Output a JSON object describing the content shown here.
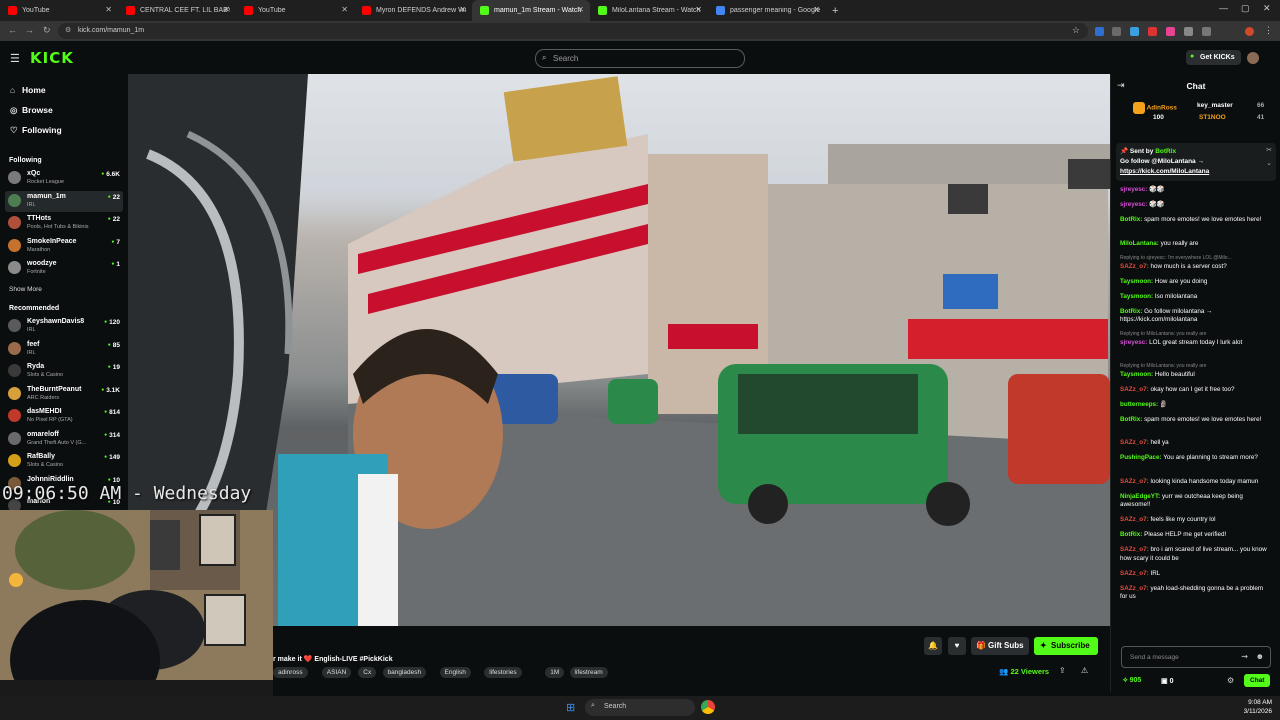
{
  "browser": {
    "tabs": [
      {
        "label": "YouTube",
        "color": "#ff0000",
        "active": false
      },
      {
        "label": "CENTRAL CEE FT. LIL BABY - BA",
        "color": "#ff0000",
        "active": false
      },
      {
        "label": "YouTube",
        "color": "#ff0000",
        "active": false
      },
      {
        "label": "Myron DEFENDS Andrew Wilso",
        "color": "#ff0000",
        "active": false
      },
      {
        "label": "mamun_1m Stream - Watch",
        "color": "#53fc18",
        "active": true
      },
      {
        "label": "MiloLantana Stream - Watch Li",
        "color": "#53fc18",
        "active": false
      },
      {
        "label": "passenger meaning - Google S",
        "color": "#4285f4",
        "active": false
      }
    ],
    "new_tab": "+",
    "url": "kick.com/mamun_1m"
  },
  "kick": {
    "logo": "KICK",
    "search_placeholder": "Search",
    "get_kicks": "Get KICKs"
  },
  "sidebar": {
    "nav": [
      {
        "label": "Home",
        "icon": "home-icon"
      },
      {
        "label": "Browse",
        "icon": "compass-icon"
      },
      {
        "label": "Following",
        "icon": "heart-icon"
      }
    ],
    "following_title": "Following",
    "following": [
      {
        "name": "xQc",
        "category": "Rocket League",
        "viewers": "6.6K",
        "color": "#7a7a7a"
      },
      {
        "name": "mamun_1m",
        "category": "IRL",
        "viewers": "22",
        "color": "#4e7d52"
      },
      {
        "name": "TTHots",
        "category": "Pools, Hot Tubs & Bikinis",
        "viewers": "22",
        "color": "#b0503a"
      },
      {
        "name": "SmokeInPeace",
        "category": "Marathon",
        "viewers": "7",
        "color": "#c4722e"
      },
      {
        "name": "woodzye",
        "category": "Fortnite",
        "viewers": "1",
        "color": "#8a8a8a"
      }
    ],
    "show_more": "Show More",
    "recommended_title": "Recommended",
    "recommended": [
      {
        "name": "KeyshawnDavis8",
        "category": "IRL",
        "viewers": "120",
        "color": "#5a5a5a"
      },
      {
        "name": "feef",
        "category": "IRL",
        "viewers": "85",
        "color": "#9a6a4a"
      },
      {
        "name": "Ryda",
        "category": "Slots & Casino",
        "viewers": "19",
        "color": "#3a3a3a"
      },
      {
        "name": "TheBurntPeanut",
        "category": "ARC Raiders",
        "viewers": "3.1K",
        "color": "#d6a13a"
      },
      {
        "name": "dasMEHDI",
        "category": "No Pixel RP (GTA)",
        "viewers": "814",
        "color": "#c0392b"
      },
      {
        "name": "omareloff",
        "category": "Grand Theft Auto V (G...",
        "viewers": "314",
        "color": "#6a6a6a"
      },
      {
        "name": "RafBally",
        "category": "Slots & Casino",
        "viewers": "149",
        "color": "#d4a017"
      },
      {
        "name": "JohnniRiddlin",
        "category": "",
        "viewers": "10",
        "color": "#7a5a3a"
      },
      {
        "name": "marlon",
        "category": "",
        "viewers": "10",
        "color": "#444"
      }
    ]
  },
  "video": {
    "clock_overlay": "09:06:50 AM - Wednesday"
  },
  "stream": {
    "title": "r make it ❤️ English-LIVE #PickKick",
    "tags": [
      "adinross",
      "ASIAN",
      "Cx",
      "bangladesh",
      "English",
      "lifestories",
      "1M",
      "lifestream"
    ],
    "gift_subs": "Gift Subs",
    "subscribe": "Subscribe",
    "viewers": "22 Viewers"
  },
  "chat": {
    "title": "Chat",
    "leaderboard": [
      {
        "name": "AdinRoss",
        "value": "100",
        "color": "#f4a11b"
      },
      {
        "name": "key_master",
        "value": "66",
        "color": "#ffffff"
      },
      {
        "name": "ST1NOO",
        "value": "41",
        "color": "#f4a11b"
      }
    ],
    "pinned": {
      "sent_by": "Sent by",
      "user": "BotRix",
      "text": "Go follow @MiloLantana →",
      "link": "https://kick.com/MiloLantana"
    },
    "messages": [
      {
        "reply": "",
        "user": "sjreyesc:",
        "color": "#d94fd9",
        "text": "🎲🎲"
      },
      {
        "reply": "",
        "user": "sjreyesc:",
        "color": "#d94fd9",
        "text": "🎲🎲"
      },
      {
        "reply": "",
        "user": "BotRix:",
        "color": "#53fc18",
        "text": "spam more emotes! we love emotes here!"
      },
      {
        "reply": "",
        "user": "MiloLantana:",
        "color": "#53fc18",
        "text": "you really are"
      },
      {
        "reply": "Replying to sjreyesc: I'm everywhere LOL @Milo...",
        "user": "",
        "color": "",
        "text": ""
      },
      {
        "reply": "",
        "user": "SAZz_o7:",
        "color": "#e74c3c",
        "text": "how much is a server cost?"
      },
      {
        "reply": "",
        "user": "Taysmoon:",
        "color": "#53fc18",
        "text": "How are you doing"
      },
      {
        "reply": "",
        "user": "Taysmoon:",
        "color": "#53fc18",
        "text": "Iso milolantana"
      },
      {
        "reply": "",
        "user": "BotRix:",
        "color": "#53fc18",
        "text": "Go follow milolantana → https://kick.com/milolantana"
      },
      {
        "reply": "Replying to MiloLantana: you really are",
        "user": "",
        "color": "",
        "text": ""
      },
      {
        "reply": "",
        "user": "sjreyesc:",
        "color": "#d94fd9",
        "text": "LOL great stream today I lurk alot"
      },
      {
        "reply": "Replying to MiloLantana: you really are",
        "user": "",
        "color": "",
        "text": ""
      },
      {
        "reply": "",
        "user": "Taysmoon:",
        "color": "#53fc18",
        "text": "Hello beautiful"
      },
      {
        "reply": "",
        "user": "SAZz_o7:",
        "color": "#e74c3c",
        "text": "okay how can I get it free too?"
      },
      {
        "reply": "",
        "user": "butterneeps:",
        "color": "#53fc18",
        "text": "🗿"
      },
      {
        "reply": "",
        "user": "BotRix:",
        "color": "#53fc18",
        "text": "spam more emotes! we love emotes here!"
      },
      {
        "reply": "",
        "user": "SAZz_o7:",
        "color": "#e74c3c",
        "text": "hell ya"
      },
      {
        "reply": "",
        "user": "PushingPace:",
        "color": "#53fc18",
        "text": "You are planning to stream more?"
      },
      {
        "reply": "",
        "user": "SAZz_o7:",
        "color": "#e74c3c",
        "text": "looking kinda handsome today mamun"
      },
      {
        "reply": "",
        "user": "NinjaEdgeYT:",
        "color": "#53fc18",
        "text": "yurr we outcheaa keep being awesome!!"
      },
      {
        "reply": "",
        "user": "SAZz_o7:",
        "color": "#e74c3c",
        "text": "feels like my country lol"
      },
      {
        "reply": "",
        "user": "BotRix:",
        "color": "#53fc18",
        "text": "Please HELP me get verified!"
      },
      {
        "reply": "",
        "user": "SAZz_o7:",
        "color": "#e74c3c",
        "text": "bro i am scared of live stream... you know how scary it could be"
      },
      {
        "reply": "",
        "user": "SAZz_o7:",
        "color": "#e74c3c",
        "text": "IRL"
      },
      {
        "reply": "",
        "user": "SAZz_o7:",
        "color": "#e74c3c",
        "text": "yeah load-shedding gonna be a problem for us"
      }
    ],
    "input_placeholder": "Send a message",
    "points": "905",
    "gifts": "0",
    "chat_button": "Chat"
  },
  "taskbar": {
    "search": "Search",
    "time": "9:08 AM",
    "date": "3/11/2026"
  },
  "colors": {
    "accent": "#53fc18",
    "background": "#0b0e0f"
  }
}
